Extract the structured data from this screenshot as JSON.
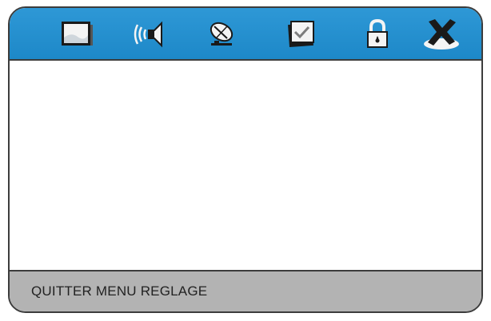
{
  "menu": {
    "icons": [
      {
        "name": "picture-icon",
        "label": ""
      },
      {
        "name": "sound-icon",
        "label": ""
      },
      {
        "name": "satellite-dish-icon",
        "label": ""
      },
      {
        "name": "settings-checklist-icon",
        "label": ""
      },
      {
        "name": "lock-icon",
        "label": ""
      },
      {
        "name": "exit-icon",
        "label": ""
      }
    ],
    "selected_icon": "exit-icon"
  },
  "status": {
    "text": "QUITTER MENU REGLAGE"
  },
  "colors": {
    "header_blue": "#1d88c8",
    "status_gray": "#b3b3b3",
    "border": "#3c3c3c"
  }
}
